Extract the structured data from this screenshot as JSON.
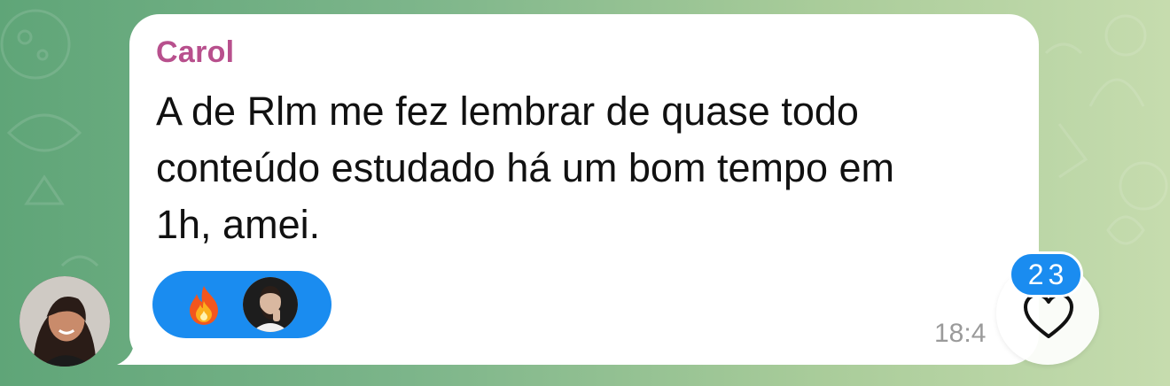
{
  "message": {
    "sender": "Carol",
    "text_lines": [
      "A de Rlm me fez lembrar de quase todo",
      "conteúdo estudado há um bom tempo em",
      "1h, amei."
    ],
    "time": "18:4"
  },
  "reactions": {
    "emoji": "🔥",
    "emoji_icon": "fire-icon",
    "reactor_icon": "reactor-avatar"
  },
  "like": {
    "count": "23",
    "icon": "heart-outline-icon"
  },
  "colors": {
    "sender": "#b8508d",
    "reaction_pill": "#1a8cf0",
    "bubble": "#ffffff",
    "background": "#7cb58a"
  }
}
